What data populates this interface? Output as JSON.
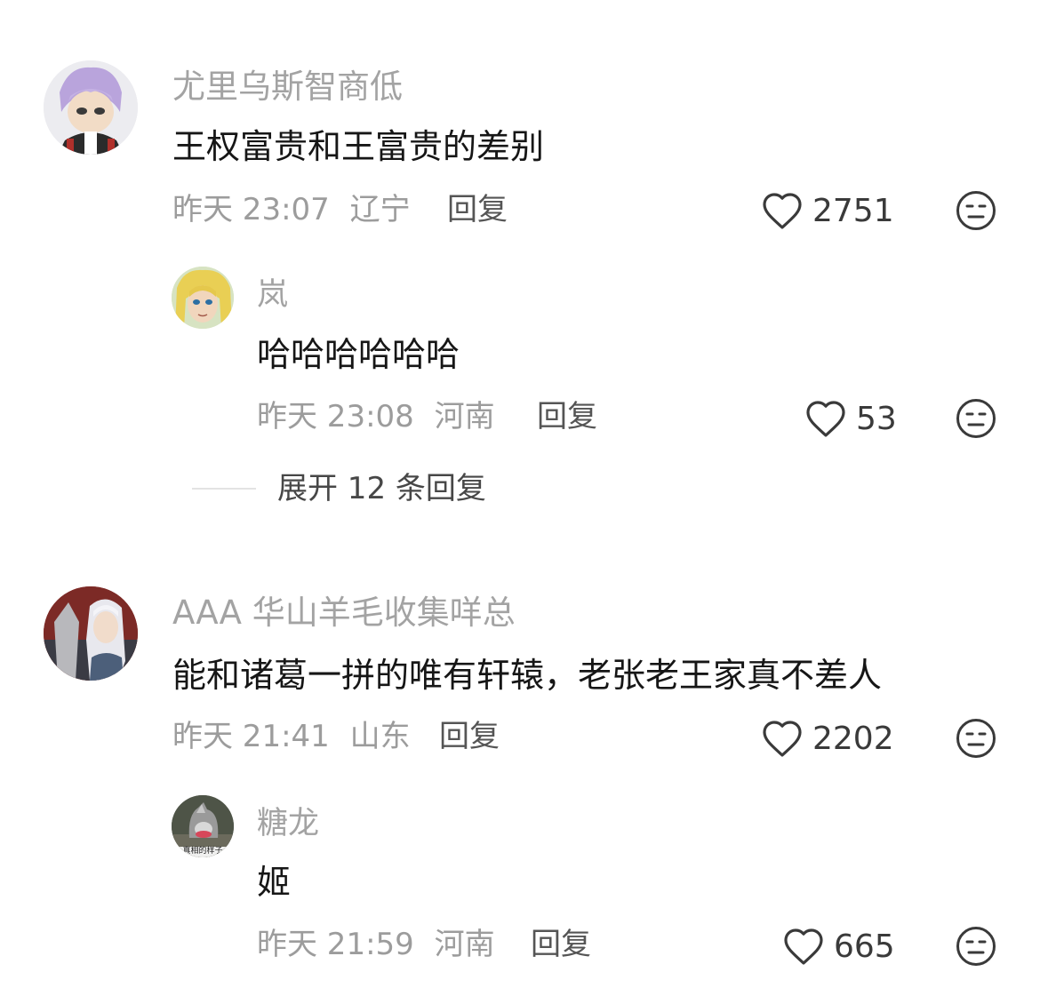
{
  "comments": [
    {
      "username": "尤里乌斯智商低",
      "text": "王权富贵和王富贵的差别",
      "time": "昨天 23:07",
      "location": "辽宁",
      "reply_label": "回复",
      "likes": "2751",
      "replies": [
        {
          "username": "岚",
          "text": "哈哈哈哈哈哈",
          "time": "昨天 23:08",
          "location": "河南",
          "reply_label": "回复",
          "likes": "53"
        }
      ],
      "expand_label": "展开 12 条回复"
    },
    {
      "username": "AAA 华山羊毛收集咩总",
      "text": "能和诸葛一拼的唯有轩辕，老张老王家真不差人",
      "time": "昨天 21:41",
      "location": "山东",
      "reply_label": "回复",
      "likes": "2202",
      "replies": [
        {
          "username": "糖龙",
          "avatar_caption": "真相的样子",
          "text": "姬",
          "time": "昨天 21:59",
          "location": "河南",
          "reply_label": "回复",
          "likes": "665"
        }
      ]
    }
  ],
  "icons": {
    "like": "heart-outline-icon",
    "dislike": "unamused-face-icon"
  }
}
